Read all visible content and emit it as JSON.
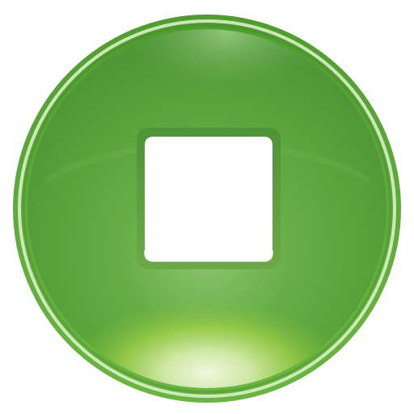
{
  "icon": {
    "name": "stop-button",
    "glyph": "stop-square-icon"
  },
  "colors": {
    "background": "#ffffff",
    "ring_outer": "#4f9c2f",
    "ring_highlight": "#d9f0c6",
    "disc_dark": "#4f9637",
    "disc_mid": "#62a845",
    "disc_light": "#8cc56f",
    "disc_lime": "#9bcf3b",
    "glow": "#f3f8df",
    "square_fill": "#ffffff",
    "square_border": "#4f9338"
  }
}
